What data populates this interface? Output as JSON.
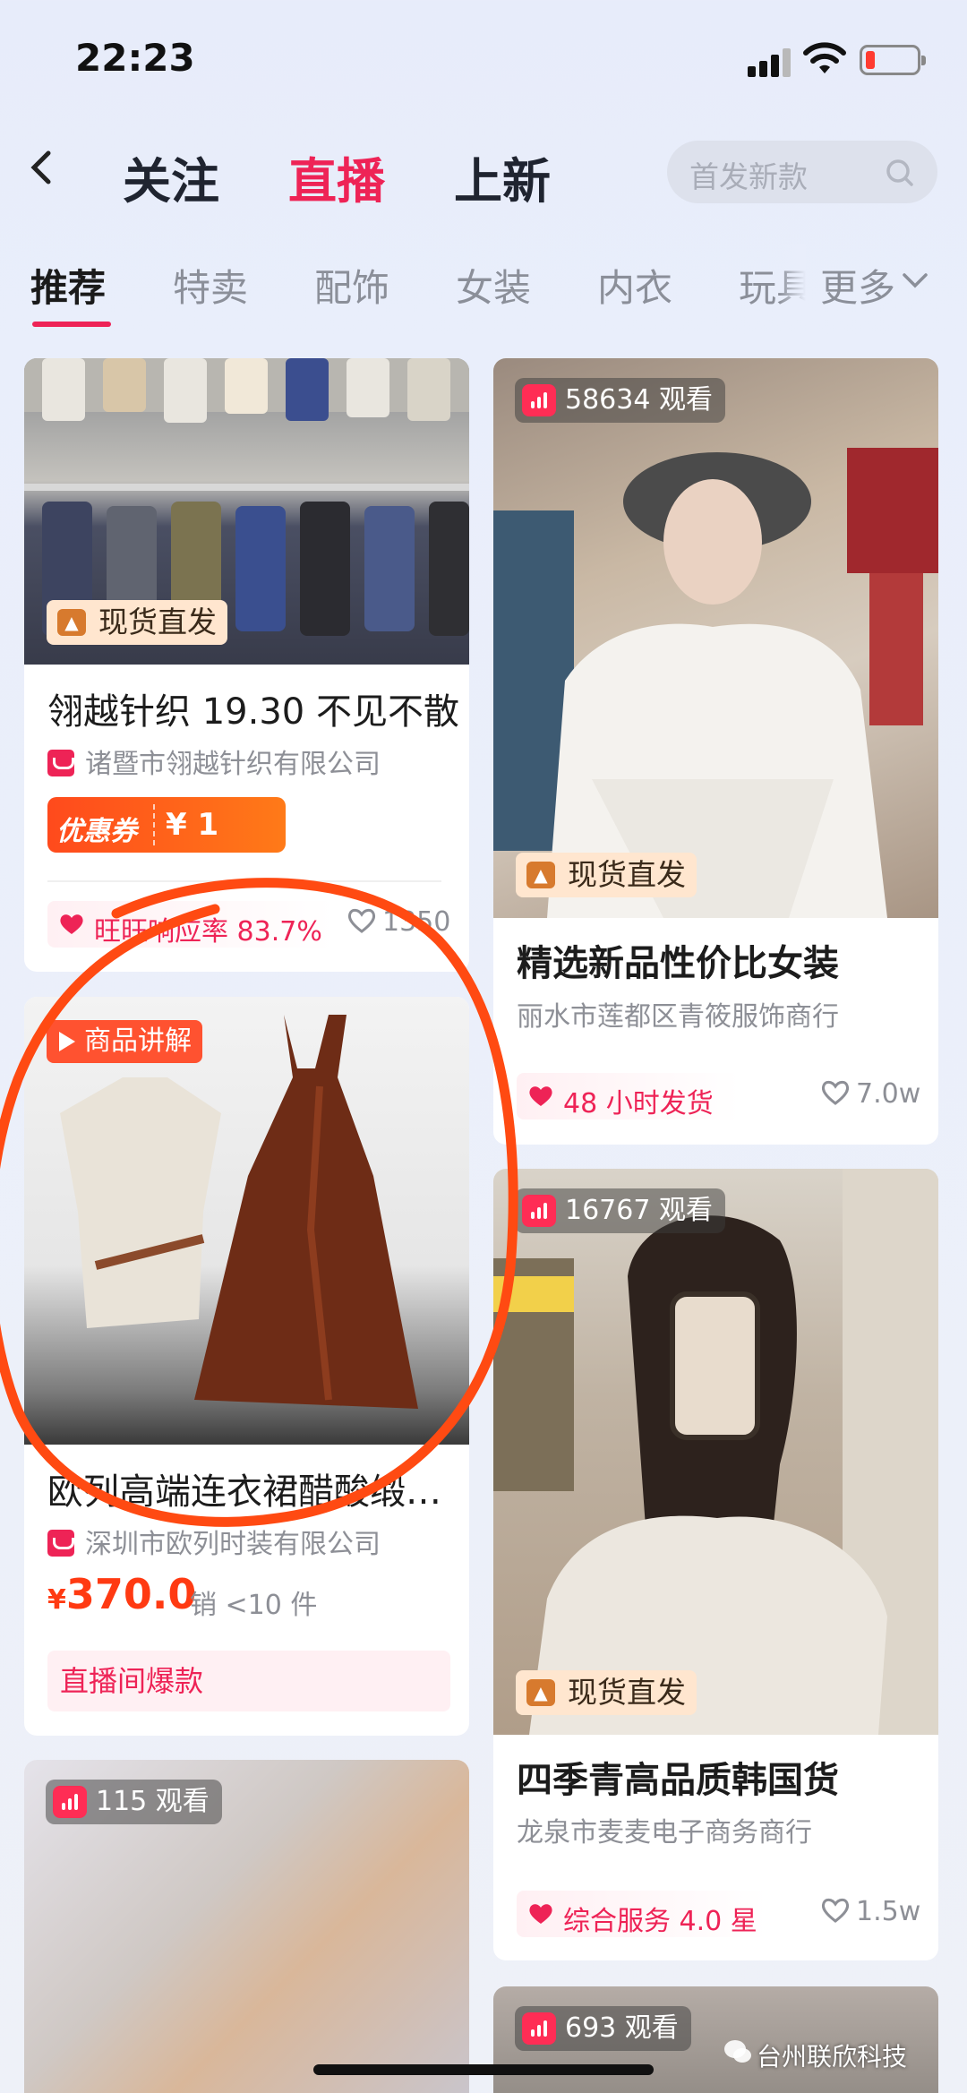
{
  "status_bar": {
    "time": "22:23"
  },
  "nav": {
    "tabs": [
      {
        "label": "关注"
      },
      {
        "label": "直播"
      },
      {
        "label": "上新"
      }
    ],
    "search_placeholder": "首发新款",
    "accent_color": "#ee2356"
  },
  "categories": {
    "items": [
      "推荐",
      "特卖",
      "配饰",
      "女装",
      "内衣",
      "玩具"
    ],
    "more_label": "更多"
  },
  "cards": {
    "c1": {
      "tag": "现货直发",
      "title": "翎越针织 19.30 不见不散",
      "shop": "诸暨市翎越针织有限公司",
      "coupon_label": "优惠券",
      "coupon_value": "¥ 1",
      "badge": "旺旺响应率 83.7%",
      "likes": "1350"
    },
    "c2": {
      "viewers": "58634 观看",
      "tag": "现货直发",
      "title": "精选新品性价比女装",
      "shop": "丽水市莲都区青筱服饰商行",
      "badge": "48 小时发货",
      "likes": "7.0w"
    },
    "c3": {
      "explain": "商品讲解",
      "title": "欧列高端连衣裙醋酸缎…",
      "shop": "深圳市欧列时装有限公司",
      "price_symbol": "¥",
      "price": "370.0",
      "sales": "销 <10 件",
      "hot": "直播间爆款"
    },
    "c4": {
      "viewers": "16767 观看",
      "tag": "现货直发",
      "title": "四季青高品质韩国货",
      "shop": "龙泉市麦麦电子商务商行",
      "badge": "综合服务 4.0 星",
      "likes": "1.5w"
    },
    "c5": {
      "viewers": "115 观看"
    },
    "c6": {
      "viewers": "693 观看"
    }
  },
  "watermark": "台州联欣科技"
}
